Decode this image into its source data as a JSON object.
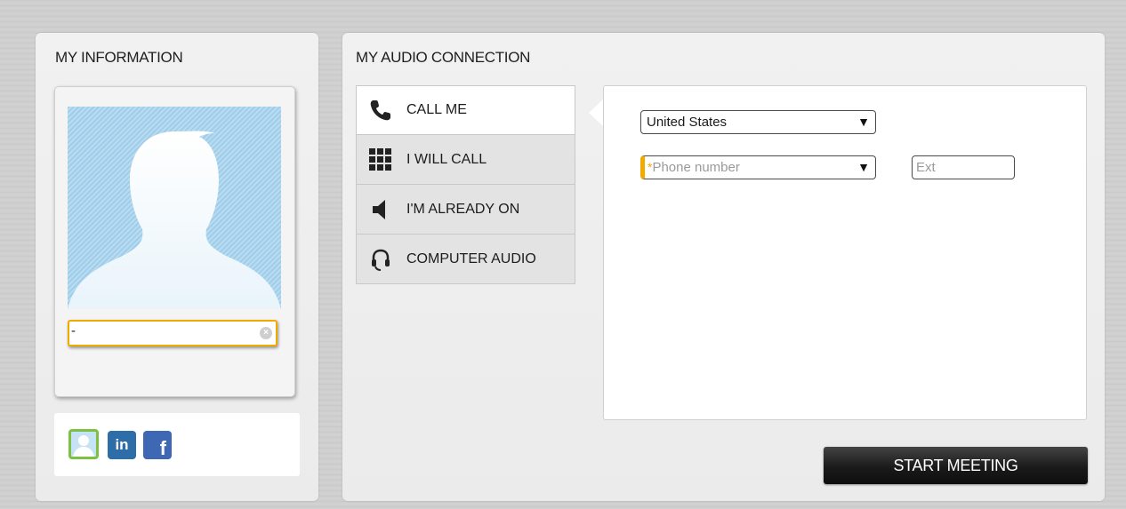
{
  "my_information": {
    "title": "MY INFORMATION",
    "name_input_value": "-",
    "social": [
      {
        "name": "profile",
        "icon": "profile-icon"
      },
      {
        "name": "linkedin",
        "label": "in",
        "icon": "linkedin-icon"
      },
      {
        "name": "facebook",
        "label": "f",
        "icon": "facebook-icon"
      }
    ]
  },
  "my_audio_connection": {
    "title": "MY AUDIO CONNECTION",
    "tabs": [
      {
        "label": "CALL ME",
        "icon": "phone-icon",
        "active": true
      },
      {
        "label": "I WILL CALL",
        "icon": "keypad-icon",
        "active": false
      },
      {
        "label": "I'M ALREADY ON",
        "icon": "speaker-icon",
        "active": false
      },
      {
        "label": "COMPUTER AUDIO",
        "icon": "headset-icon",
        "active": false
      }
    ],
    "country_select": {
      "value": "United States"
    },
    "phone_select": {
      "required_mark": "*",
      "placeholder": "Phone number"
    },
    "ext_input": {
      "placeholder": "Ext"
    },
    "start_button": "START MEETING"
  },
  "colors": {
    "accent_orange": "#f2a900",
    "button_dark": "#1a1a1a",
    "profile_green": "#7cc242",
    "linkedin_blue": "#2d6ea8",
    "facebook_blue": "#3e68b3"
  }
}
